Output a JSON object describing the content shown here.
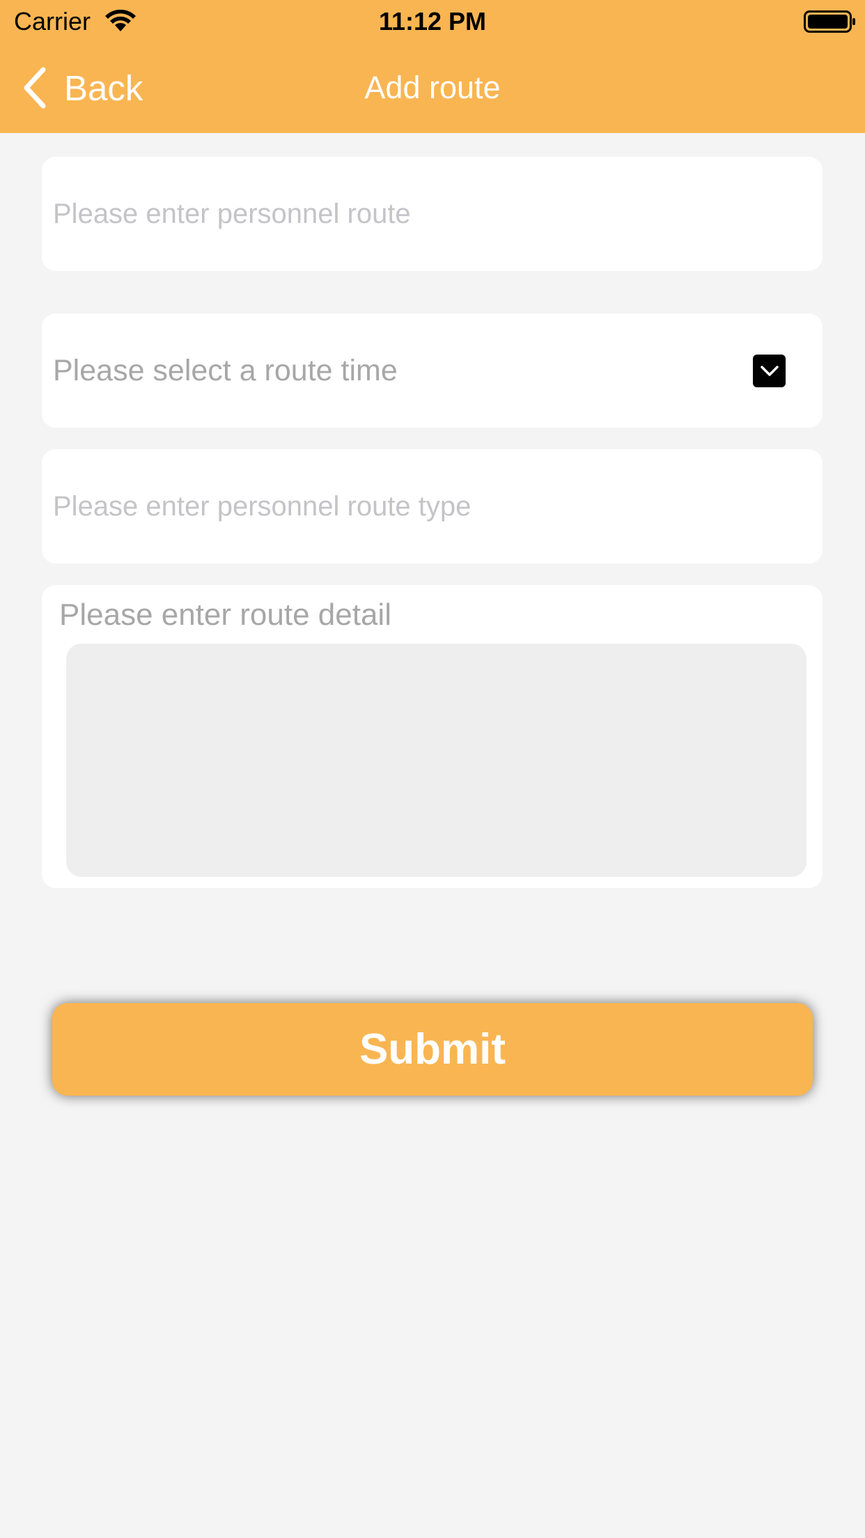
{
  "status_bar": {
    "carrier": "Carrier",
    "time": "11:12 PM"
  },
  "nav": {
    "back_label": "Back",
    "title": "Add route"
  },
  "form": {
    "route_placeholder": "Please enter personnel route",
    "route_time_label": "Please select a  route time",
    "route_type_placeholder": "Please enter personnel route type",
    "detail_label": "Please enter route detail",
    "detail_value": ""
  },
  "submit_label": "Submit",
  "colors": {
    "accent": "#f9b552",
    "background": "#f4f4f4",
    "placeholder": "#c4c4c8",
    "label": "#a7a7a7"
  },
  "icons": {
    "back": "chevron-left-icon",
    "wifi": "wifi-icon",
    "battery": "battery-icon",
    "dropdown": "chevron-down-icon"
  }
}
